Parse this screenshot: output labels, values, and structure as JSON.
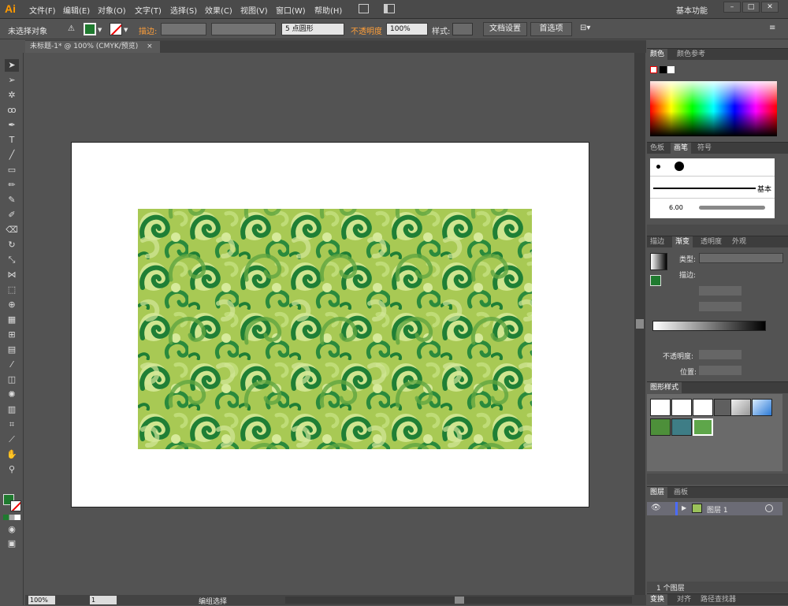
{
  "app": {
    "logo": "Ai"
  },
  "menu": [
    "文件(F)",
    "编辑(E)",
    "对象(O)",
    "文字(T)",
    "选择(S)",
    "效果(C)",
    "视图(V)",
    "窗口(W)",
    "帮助(H)"
  ],
  "workspace_switcher": "基本功能",
  "control_bar": {
    "selection_status": "未选择对象",
    "stroke_label": "描边:",
    "brush_point": "5 点圆形",
    "opacity_label": "不透明度",
    "opacity_value": "100%",
    "style_label": "样式:",
    "doc_setup_button": "文档设置",
    "preferences_button": "首选项"
  },
  "document": {
    "tab_title": "未标题-1* @ 100% (CMYK/预览)",
    "close": "×"
  },
  "status_bar": {
    "zoom": "100%",
    "artboard_num": "1",
    "status_text": "编组选择"
  },
  "panels": {
    "color": {
      "tabs": [
        "颜色",
        "颜色参考"
      ]
    },
    "brushes": {
      "tabs": [
        "色板",
        "画笔",
        "符号"
      ],
      "basic_label": "基本",
      "brush_size": "6.00"
    },
    "gradient": {
      "tabs": [
        "描边",
        "渐变",
        "透明度",
        "外观"
      ],
      "type_label": "类型:",
      "stroke_label": "描边:",
      "opacity_label": "不透明度:",
      "position_label": "位置:"
    },
    "graphic_styles": {
      "tabs": [
        "图形样式"
      ]
    },
    "layers": {
      "tabs": [
        "图层",
        "画板"
      ],
      "layer_name": "图层 1",
      "footer_count": "1 个图层"
    },
    "bottom": {
      "tabs": [
        "变换",
        "对齐",
        "路径查找器"
      ]
    }
  },
  "colors": {
    "fill": "#1f7a2f",
    "accent_orange": "#ff9a00",
    "pattern_light": "#b5d46a",
    "pattern_dark": "#1f7f35"
  }
}
